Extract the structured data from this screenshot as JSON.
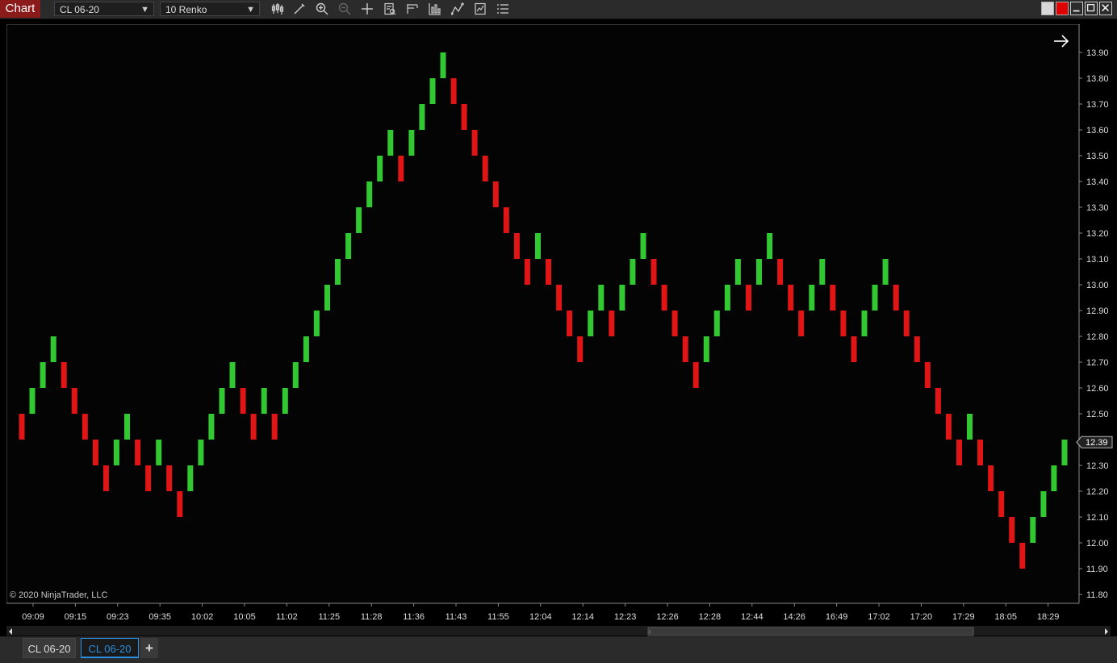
{
  "window": {
    "title": "Chart",
    "instrument": "CL 06-20",
    "bar_type": "10 Renko",
    "colors": {
      "title_tab": "#8b1a1a",
      "up_bar": "#32c832",
      "down_bar": "#e11515",
      "background": "#000000"
    }
  },
  "toolbar": {
    "icons": [
      "bars-icon",
      "pencil-icon",
      "zoom-in-icon",
      "zoom-out-icon",
      "crosshair-icon",
      "data-box-icon",
      "properties-icon",
      "indicators-icon",
      "strategies-icon",
      "chart-trader-icon",
      "templates-icon"
    ]
  },
  "chart": {
    "copyright": "© 2020 NinjaTrader, LLC",
    "last_price_label": "12.39"
  },
  "chart_data": {
    "type": "renko",
    "brick_size": 0.1,
    "ylim": [
      11.75,
      13.96
    ],
    "y_ticks": [
      11.8,
      11.9,
      12.0,
      12.1,
      12.2,
      12.3,
      12.4,
      12.5,
      12.6,
      12.7,
      12.8,
      12.9,
      13.0,
      13.1,
      13.2,
      13.3,
      13.4,
      13.5,
      13.6,
      13.7,
      13.8,
      13.9
    ],
    "y_tick_labels": [
      "11.80",
      "11.90",
      "12.00",
      "12.10",
      "12.20",
      "12.30",
      "12.40",
      "12.50",
      "12.60",
      "12.70",
      "12.80",
      "12.90",
      "13.00",
      "13.10",
      "13.20",
      "13.30",
      "13.40",
      "13.50",
      "13.60",
      "13.70",
      "13.80",
      "13.90"
    ],
    "x_tick_labels": [
      "09:09",
      "09:15",
      "09:23",
      "09:35",
      "10:02",
      "10:05",
      "11:02",
      "11:25",
      "11:28",
      "11:36",
      "11:43",
      "11:55",
      "12:04",
      "12:14",
      "12:23",
      "12:26",
      "12:28",
      "12:44",
      "14:26",
      "16:49",
      "17:02",
      "17:20",
      "17:29",
      "18:05",
      "18:29"
    ],
    "last_price": 12.39,
    "bricks": [
      {
        "low": 12.4,
        "high": 12.5,
        "dir": "down"
      },
      {
        "low": 12.5,
        "high": 12.6,
        "dir": "up"
      },
      {
        "low": 12.6,
        "high": 12.7,
        "dir": "up"
      },
      {
        "low": 12.7,
        "high": 12.8,
        "dir": "up"
      },
      {
        "low": 12.6,
        "high": 12.7,
        "dir": "down"
      },
      {
        "low": 12.5,
        "high": 12.6,
        "dir": "down"
      },
      {
        "low": 12.4,
        "high": 12.5,
        "dir": "down"
      },
      {
        "low": 12.3,
        "high": 12.4,
        "dir": "down"
      },
      {
        "low": 12.2,
        "high": 12.3,
        "dir": "down"
      },
      {
        "low": 12.3,
        "high": 12.4,
        "dir": "up"
      },
      {
        "low": 12.4,
        "high": 12.5,
        "dir": "up"
      },
      {
        "low": 12.3,
        "high": 12.4,
        "dir": "down"
      },
      {
        "low": 12.2,
        "high": 12.3,
        "dir": "down"
      },
      {
        "low": 12.3,
        "high": 12.4,
        "dir": "up"
      },
      {
        "low": 12.2,
        "high": 12.3,
        "dir": "down"
      },
      {
        "low": 12.1,
        "high": 12.2,
        "dir": "down"
      },
      {
        "low": 12.2,
        "high": 12.3,
        "dir": "up"
      },
      {
        "low": 12.3,
        "high": 12.4,
        "dir": "up"
      },
      {
        "low": 12.4,
        "high": 12.5,
        "dir": "up"
      },
      {
        "low": 12.5,
        "high": 12.6,
        "dir": "up"
      },
      {
        "low": 12.6,
        "high": 12.7,
        "dir": "up"
      },
      {
        "low": 12.5,
        "high": 12.6,
        "dir": "down"
      },
      {
        "low": 12.4,
        "high": 12.5,
        "dir": "down"
      },
      {
        "low": 12.5,
        "high": 12.6,
        "dir": "up"
      },
      {
        "low": 12.4,
        "high": 12.5,
        "dir": "down"
      },
      {
        "low": 12.5,
        "high": 12.6,
        "dir": "up"
      },
      {
        "low": 12.6,
        "high": 12.7,
        "dir": "up"
      },
      {
        "low": 12.7,
        "high": 12.8,
        "dir": "up"
      },
      {
        "low": 12.8,
        "high": 12.9,
        "dir": "up"
      },
      {
        "low": 12.9,
        "high": 13.0,
        "dir": "up"
      },
      {
        "low": 13.0,
        "high": 13.1,
        "dir": "up"
      },
      {
        "low": 13.1,
        "high": 13.2,
        "dir": "up"
      },
      {
        "low": 13.2,
        "high": 13.3,
        "dir": "up"
      },
      {
        "low": 13.3,
        "high": 13.4,
        "dir": "up"
      },
      {
        "low": 13.4,
        "high": 13.5,
        "dir": "up"
      },
      {
        "low": 13.5,
        "high": 13.6,
        "dir": "up"
      },
      {
        "low": 13.4,
        "high": 13.5,
        "dir": "down"
      },
      {
        "low": 13.5,
        "high": 13.6,
        "dir": "up"
      },
      {
        "low": 13.6,
        "high": 13.7,
        "dir": "up"
      },
      {
        "low": 13.7,
        "high": 13.8,
        "dir": "up"
      },
      {
        "low": 13.8,
        "high": 13.9,
        "dir": "up"
      },
      {
        "low": 13.7,
        "high": 13.8,
        "dir": "down"
      },
      {
        "low": 13.6,
        "high": 13.7,
        "dir": "down"
      },
      {
        "low": 13.5,
        "high": 13.6,
        "dir": "down"
      },
      {
        "low": 13.4,
        "high": 13.5,
        "dir": "down"
      },
      {
        "low": 13.3,
        "high": 13.4,
        "dir": "down"
      },
      {
        "low": 13.2,
        "high": 13.3,
        "dir": "down"
      },
      {
        "low": 13.1,
        "high": 13.2,
        "dir": "down"
      },
      {
        "low": 13.0,
        "high": 13.1,
        "dir": "down"
      },
      {
        "low": 13.1,
        "high": 13.2,
        "dir": "up"
      },
      {
        "low": 13.0,
        "high": 13.1,
        "dir": "down"
      },
      {
        "low": 12.9,
        "high": 13.0,
        "dir": "down"
      },
      {
        "low": 12.8,
        "high": 12.9,
        "dir": "down"
      },
      {
        "low": 12.7,
        "high": 12.8,
        "dir": "down"
      },
      {
        "low": 12.8,
        "high": 12.9,
        "dir": "up"
      },
      {
        "low": 12.9,
        "high": 13.0,
        "dir": "up"
      },
      {
        "low": 12.8,
        "high": 12.9,
        "dir": "down"
      },
      {
        "low": 12.9,
        "high": 13.0,
        "dir": "up"
      },
      {
        "low": 13.0,
        "high": 13.1,
        "dir": "up"
      },
      {
        "low": 13.1,
        "high": 13.2,
        "dir": "up"
      },
      {
        "low": 13.0,
        "high": 13.1,
        "dir": "down"
      },
      {
        "low": 12.9,
        "high": 13.0,
        "dir": "down"
      },
      {
        "low": 12.8,
        "high": 12.9,
        "dir": "down"
      },
      {
        "low": 12.7,
        "high": 12.8,
        "dir": "down"
      },
      {
        "low": 12.6,
        "high": 12.7,
        "dir": "down"
      },
      {
        "low": 12.7,
        "high": 12.8,
        "dir": "up"
      },
      {
        "low": 12.8,
        "high": 12.9,
        "dir": "up"
      },
      {
        "low": 12.9,
        "high": 13.0,
        "dir": "up"
      },
      {
        "low": 13.0,
        "high": 13.1,
        "dir": "up"
      },
      {
        "low": 12.9,
        "high": 13.0,
        "dir": "down"
      },
      {
        "low": 13.0,
        "high": 13.1,
        "dir": "up"
      },
      {
        "low": 13.1,
        "high": 13.2,
        "dir": "up"
      },
      {
        "low": 13.0,
        "high": 13.1,
        "dir": "down"
      },
      {
        "low": 12.9,
        "high": 13.0,
        "dir": "down"
      },
      {
        "low": 12.8,
        "high": 12.9,
        "dir": "down"
      },
      {
        "low": 12.9,
        "high": 13.0,
        "dir": "up"
      },
      {
        "low": 13.0,
        "high": 13.1,
        "dir": "up"
      },
      {
        "low": 12.9,
        "high": 13.0,
        "dir": "down"
      },
      {
        "low": 12.8,
        "high": 12.9,
        "dir": "down"
      },
      {
        "low": 12.7,
        "high": 12.8,
        "dir": "down"
      },
      {
        "low": 12.8,
        "high": 12.9,
        "dir": "up"
      },
      {
        "low": 12.9,
        "high": 13.0,
        "dir": "up"
      },
      {
        "low": 13.0,
        "high": 13.1,
        "dir": "up"
      },
      {
        "low": 12.9,
        "high": 13.0,
        "dir": "down"
      },
      {
        "low": 12.8,
        "high": 12.9,
        "dir": "down"
      },
      {
        "low": 12.7,
        "high": 12.8,
        "dir": "down"
      },
      {
        "low": 12.6,
        "high": 12.7,
        "dir": "down"
      },
      {
        "low": 12.5,
        "high": 12.6,
        "dir": "down"
      },
      {
        "low": 12.4,
        "high": 12.5,
        "dir": "down"
      },
      {
        "low": 12.3,
        "high": 12.4,
        "dir": "down"
      },
      {
        "low": 12.4,
        "high": 12.5,
        "dir": "up"
      },
      {
        "low": 12.3,
        "high": 12.4,
        "dir": "down"
      },
      {
        "low": 12.2,
        "high": 12.3,
        "dir": "down"
      },
      {
        "low": 12.1,
        "high": 12.2,
        "dir": "down"
      },
      {
        "low": 12.0,
        "high": 12.1,
        "dir": "down"
      },
      {
        "low": 11.9,
        "high": 12.0,
        "dir": "down"
      },
      {
        "low": 12.0,
        "high": 12.1,
        "dir": "up"
      },
      {
        "low": 12.1,
        "high": 12.2,
        "dir": "up"
      },
      {
        "low": 12.2,
        "high": 12.3,
        "dir": "up"
      },
      {
        "low": 12.3,
        "high": 12.4,
        "dir": "up"
      }
    ]
  },
  "tabs": [
    {
      "label": "CL 06-20",
      "active": false
    },
    {
      "label": "CL 06-20",
      "active": true
    }
  ],
  "add_tab_label": "+"
}
